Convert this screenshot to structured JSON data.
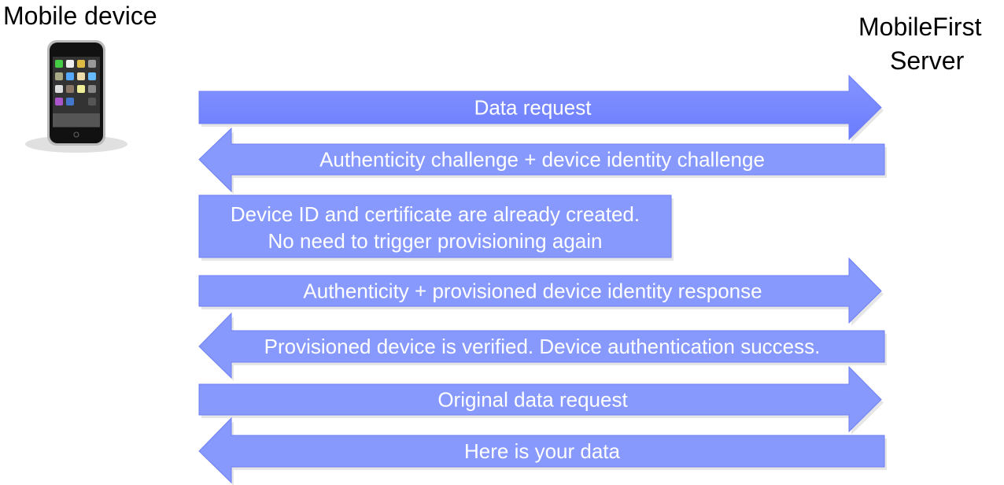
{
  "left_actor": {
    "title": "Mobile device",
    "icon": "smartphone-icon"
  },
  "right_actor": {
    "title_line1": "MobileFirst",
    "title_line2": "Server"
  },
  "colors": {
    "arrow_dark": "#6f80fd",
    "arrow": "#8799fd",
    "arrow_border": "#6f80f5",
    "shadow": "#e6e6e6"
  },
  "messages": [
    {
      "direction": "right",
      "label": "Data request"
    },
    {
      "direction": "left",
      "label": "Authenticity challenge + device identity challenge"
    },
    {
      "direction": "none",
      "line1": "Device ID and certificate are already created.",
      "line2": "No need to trigger provisioning again"
    },
    {
      "direction": "right",
      "label": "Authenticity + provisioned device identity response"
    },
    {
      "direction": "left",
      "label": "Provisioned device is verified. Device authentication success."
    },
    {
      "direction": "right",
      "label": "Original data request"
    },
    {
      "direction": "left",
      "label": "Here is your data"
    }
  ]
}
